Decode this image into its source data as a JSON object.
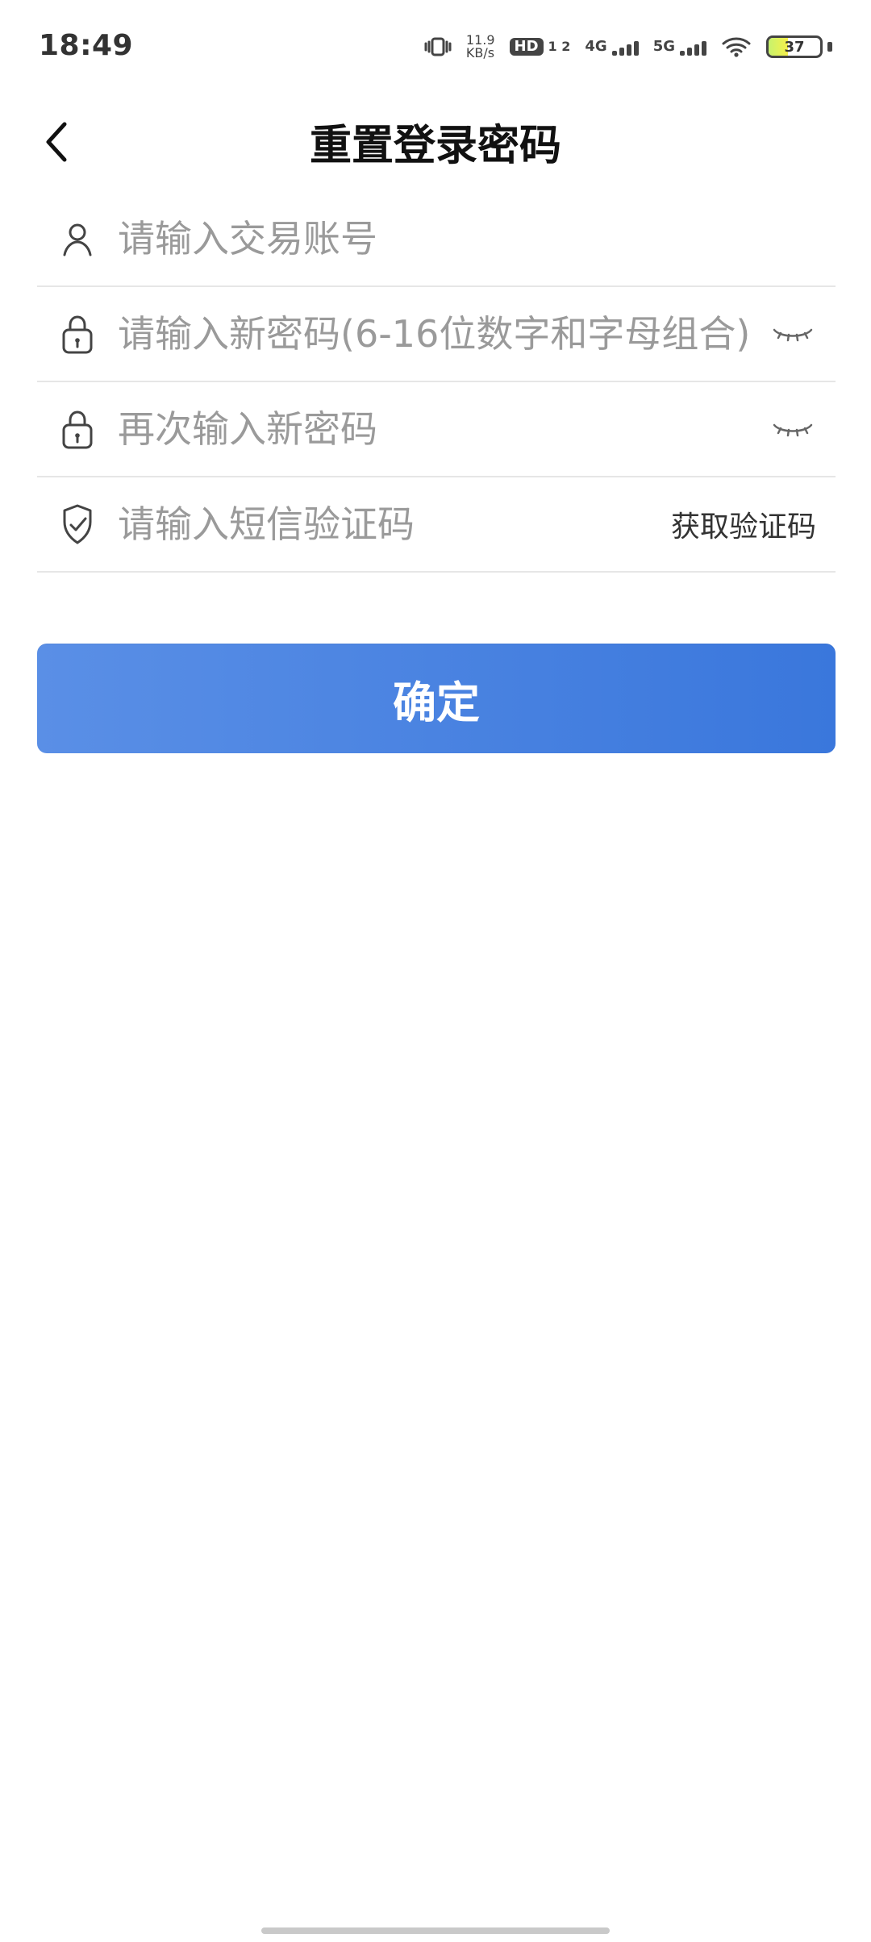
{
  "status_bar": {
    "time": "18:49",
    "net_speed_value": "11.9",
    "net_speed_unit": "KB/s",
    "hd_label": "HD",
    "sim_indicator": "1 2",
    "net_4g": "4G",
    "net_5g": "5G",
    "battery_level": 37
  },
  "header": {
    "title": "重置登录密码"
  },
  "form": {
    "account_placeholder": "请输入交易账号",
    "new_password_placeholder": "请输入新密码(6-16位数字和字母组合)",
    "confirm_password_placeholder": "再次输入新密码",
    "sms_code_placeholder": "请输入短信验证码",
    "get_code_label": "获取验证码"
  },
  "actions": {
    "confirm_label": "确定"
  },
  "colors": {
    "primary_gradient_start": "#5A8FE6",
    "primary_gradient_end": "#3A77DC",
    "divider": "#E6E6E6",
    "placeholder": "#9A9A9A",
    "text": "#111111"
  }
}
